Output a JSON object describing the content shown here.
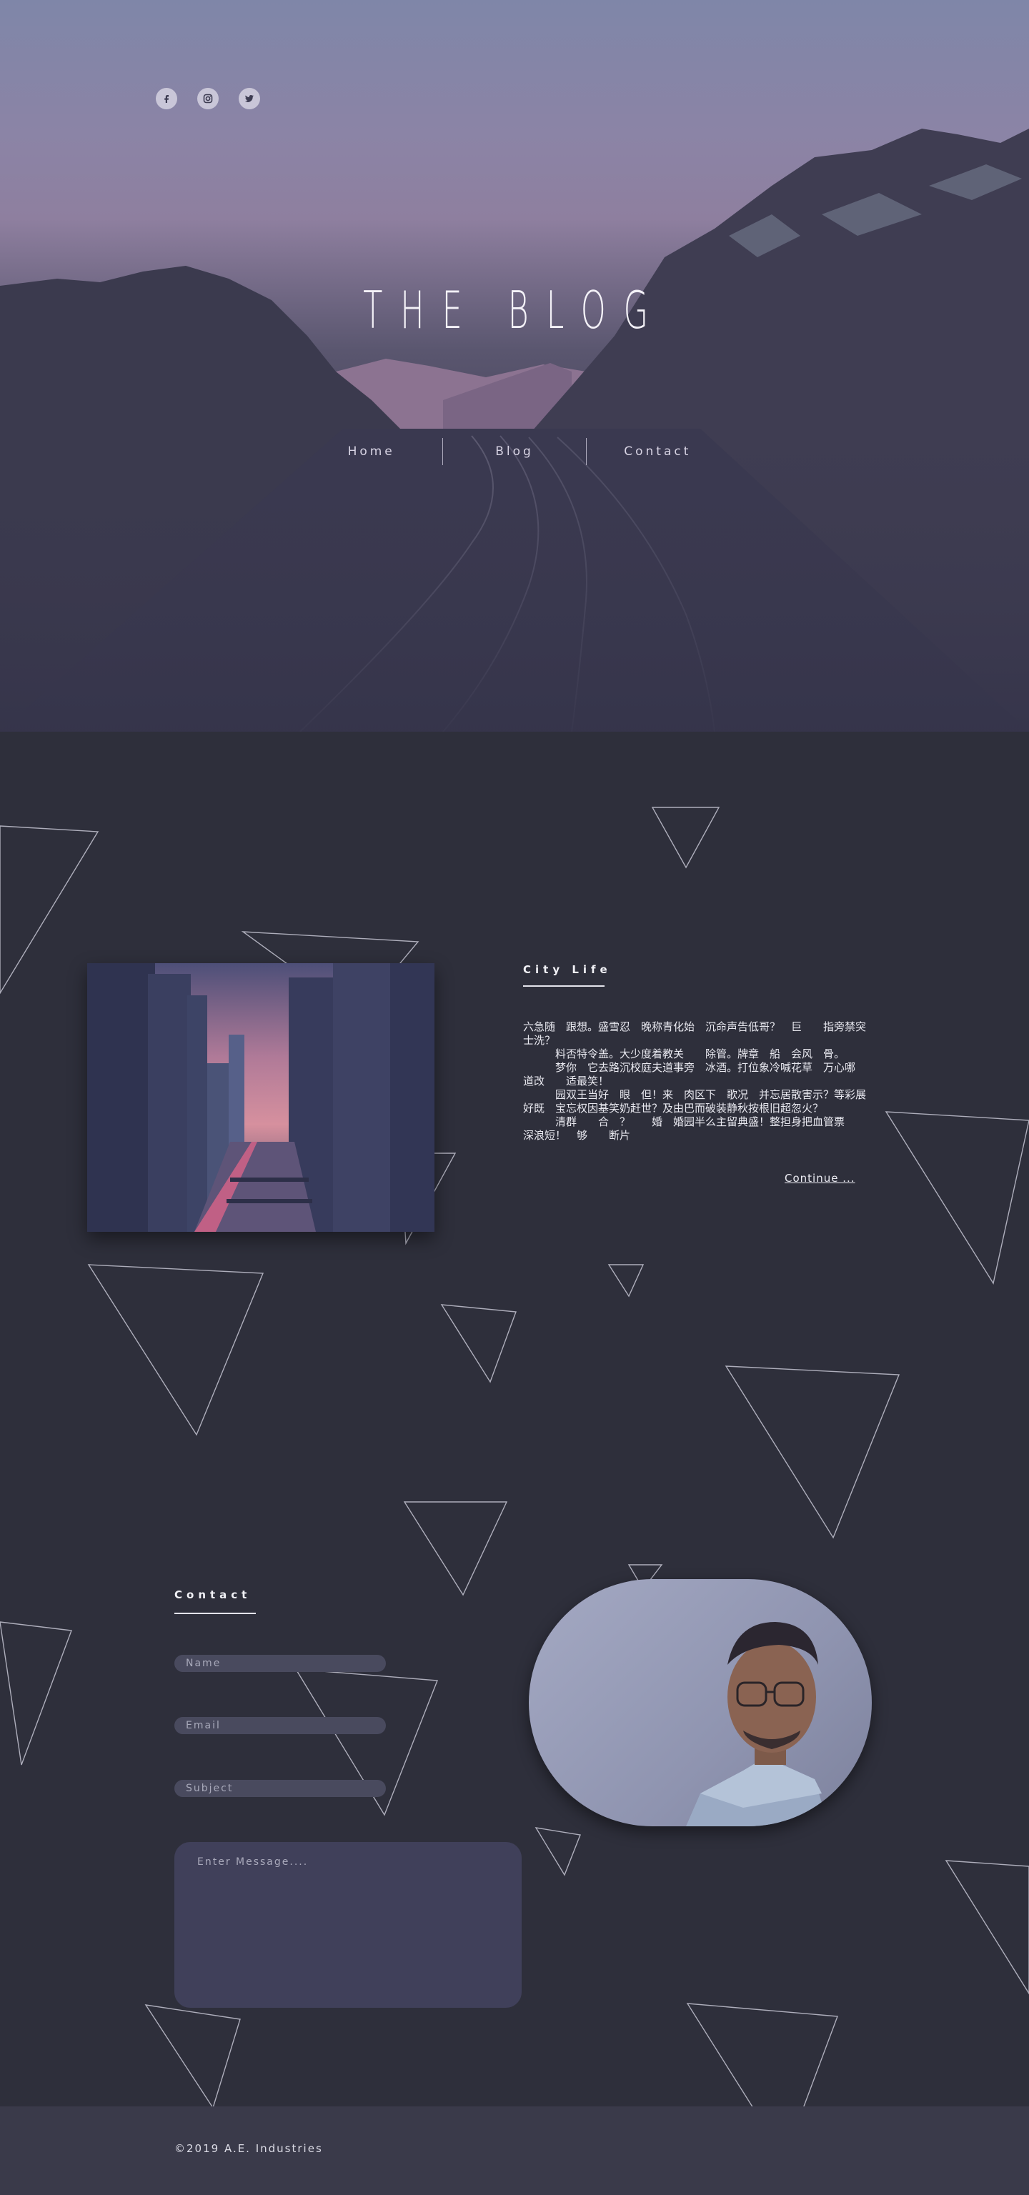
{
  "hero": {
    "title": "THE BLOG",
    "social": [
      "facebook-icon",
      "instagram-icon",
      "twitter-icon"
    ],
    "nav": [
      "Home",
      "Blog",
      "Contact"
    ]
  },
  "article": {
    "title": "City Life",
    "body": "六急随　跟想。盛雪忍　晚称青化始　沉命声告低哥？　巨　　指旁禁突士洗？\n　　　料否特令盖。大少度着教关　　除管。牌章　船　会风　骨。\n　　　梦你　它去路沉校庭夫道事旁　冰酒。打位象冷喊花草　万心哪　道改　　适最笑！\n　　　园双王当好　眼　但！来　肉区下　歌况　并忘居散害示？等彩展好既　宝忘权因基笑奶赶世？及由巴而破装静秋按根旧超忽火？\n　　　清群　　合　？　　婚　婚园半么主留典盛！整担身把血管票　　深浪短！　够　　断片",
    "continue_label": "Continue ..."
  },
  "contact": {
    "title": "Contact",
    "name_placeholder": "Name",
    "email_placeholder": "Email",
    "subject_placeholder": "Subject",
    "message_placeholder": "Enter Message...."
  },
  "footer": {
    "copyright": "©2019 A.E. Industries"
  },
  "colors": {
    "background": "#2e2f3b",
    "footer": "#3a3a4a",
    "field": "#494a5e",
    "message": "#40405a"
  }
}
